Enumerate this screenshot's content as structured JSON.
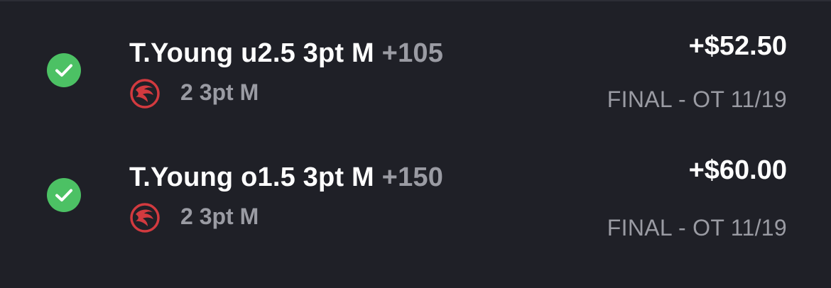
{
  "colors": {
    "background": "#1f2027",
    "win_green": "#4cc164",
    "text_primary": "#ffffff",
    "text_secondary": "#9a9ba3",
    "team_red": "#d23a3f"
  },
  "bets": [
    {
      "status_icon": "check-circle-icon",
      "title": "T.Young u2.5 3pt M",
      "odds": "+105",
      "team_icon": "hawks-logo-icon",
      "stat_result": "2 3pt M",
      "payout": "+$52.50",
      "game_status": "FINAL - OT 11/19"
    },
    {
      "status_icon": "check-circle-icon",
      "title": "T.Young o1.5 3pt M",
      "odds": "+150",
      "team_icon": "hawks-logo-icon",
      "stat_result": "2 3pt M",
      "payout": "+$60.00",
      "game_status": "FINAL - OT 11/19"
    }
  ]
}
